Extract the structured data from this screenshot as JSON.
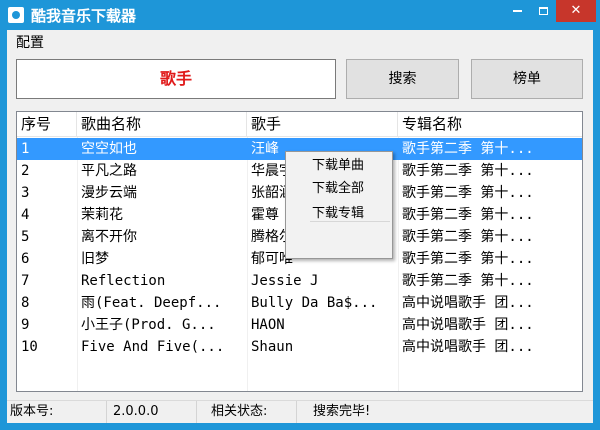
{
  "window": {
    "title": "酷我音乐下载器"
  },
  "menu": {
    "config": "配置"
  },
  "toolbar": {
    "search_mode": "歌手",
    "search_button": "搜索",
    "chart_button": "榜单",
    "accent_color": "#e01a1a"
  },
  "list": {
    "columns": [
      "序号",
      "歌曲名称",
      "歌手",
      "专辑名称"
    ],
    "selected_index": 0,
    "rows": [
      {
        "idx": "1",
        "song": "空空如也",
        "artist": "汪峰",
        "album": "歌手第二季 第十..."
      },
      {
        "idx": "2",
        "song": "平凡之路",
        "artist": "华晨宇",
        "album": "歌手第二季 第十..."
      },
      {
        "idx": "3",
        "song": "漫步云端",
        "artist": "张韶涵",
        "album": "歌手第二季 第十..."
      },
      {
        "idx": "4",
        "song": "茉莉花",
        "artist": "霍尊",
        "album": "歌手第二季 第十..."
      },
      {
        "idx": "5",
        "song": "离不开你",
        "artist": "腾格尔",
        "album": "歌手第二季 第十..."
      },
      {
        "idx": "6",
        "song": "旧梦",
        "artist": "郁可唯",
        "album": "歌手第二季 第十..."
      },
      {
        "idx": "7",
        "song": "Reflection",
        "artist": "Jessie J",
        "album": "歌手第二季 第十..."
      },
      {
        "idx": "8",
        "song": "雨(Feat. Deepf...",
        "artist": "Bully Da Ba$...",
        "album": "高中说唱歌手 团..."
      },
      {
        "idx": "9",
        "song": "小王子(Prod. G...",
        "artist": "HAON",
        "album": "高中说唱歌手 团..."
      },
      {
        "idx": "10",
        "song": "Five And Five(...",
        "artist": "Shaun",
        "album": "高中说唱歌手 团..."
      }
    ],
    "selection_color": "#3399ff"
  },
  "context_menu": {
    "items": [
      "下载单曲",
      "下载全部",
      "下载专辑"
    ]
  },
  "statusbar": {
    "version_label": "版本号:",
    "version": "2.0.0.0",
    "status_label": "相关状态:",
    "status": "搜索完毕!"
  },
  "theme": {
    "titlebar_color": "#1e96d8",
    "close_button_color": "#c7362b"
  }
}
